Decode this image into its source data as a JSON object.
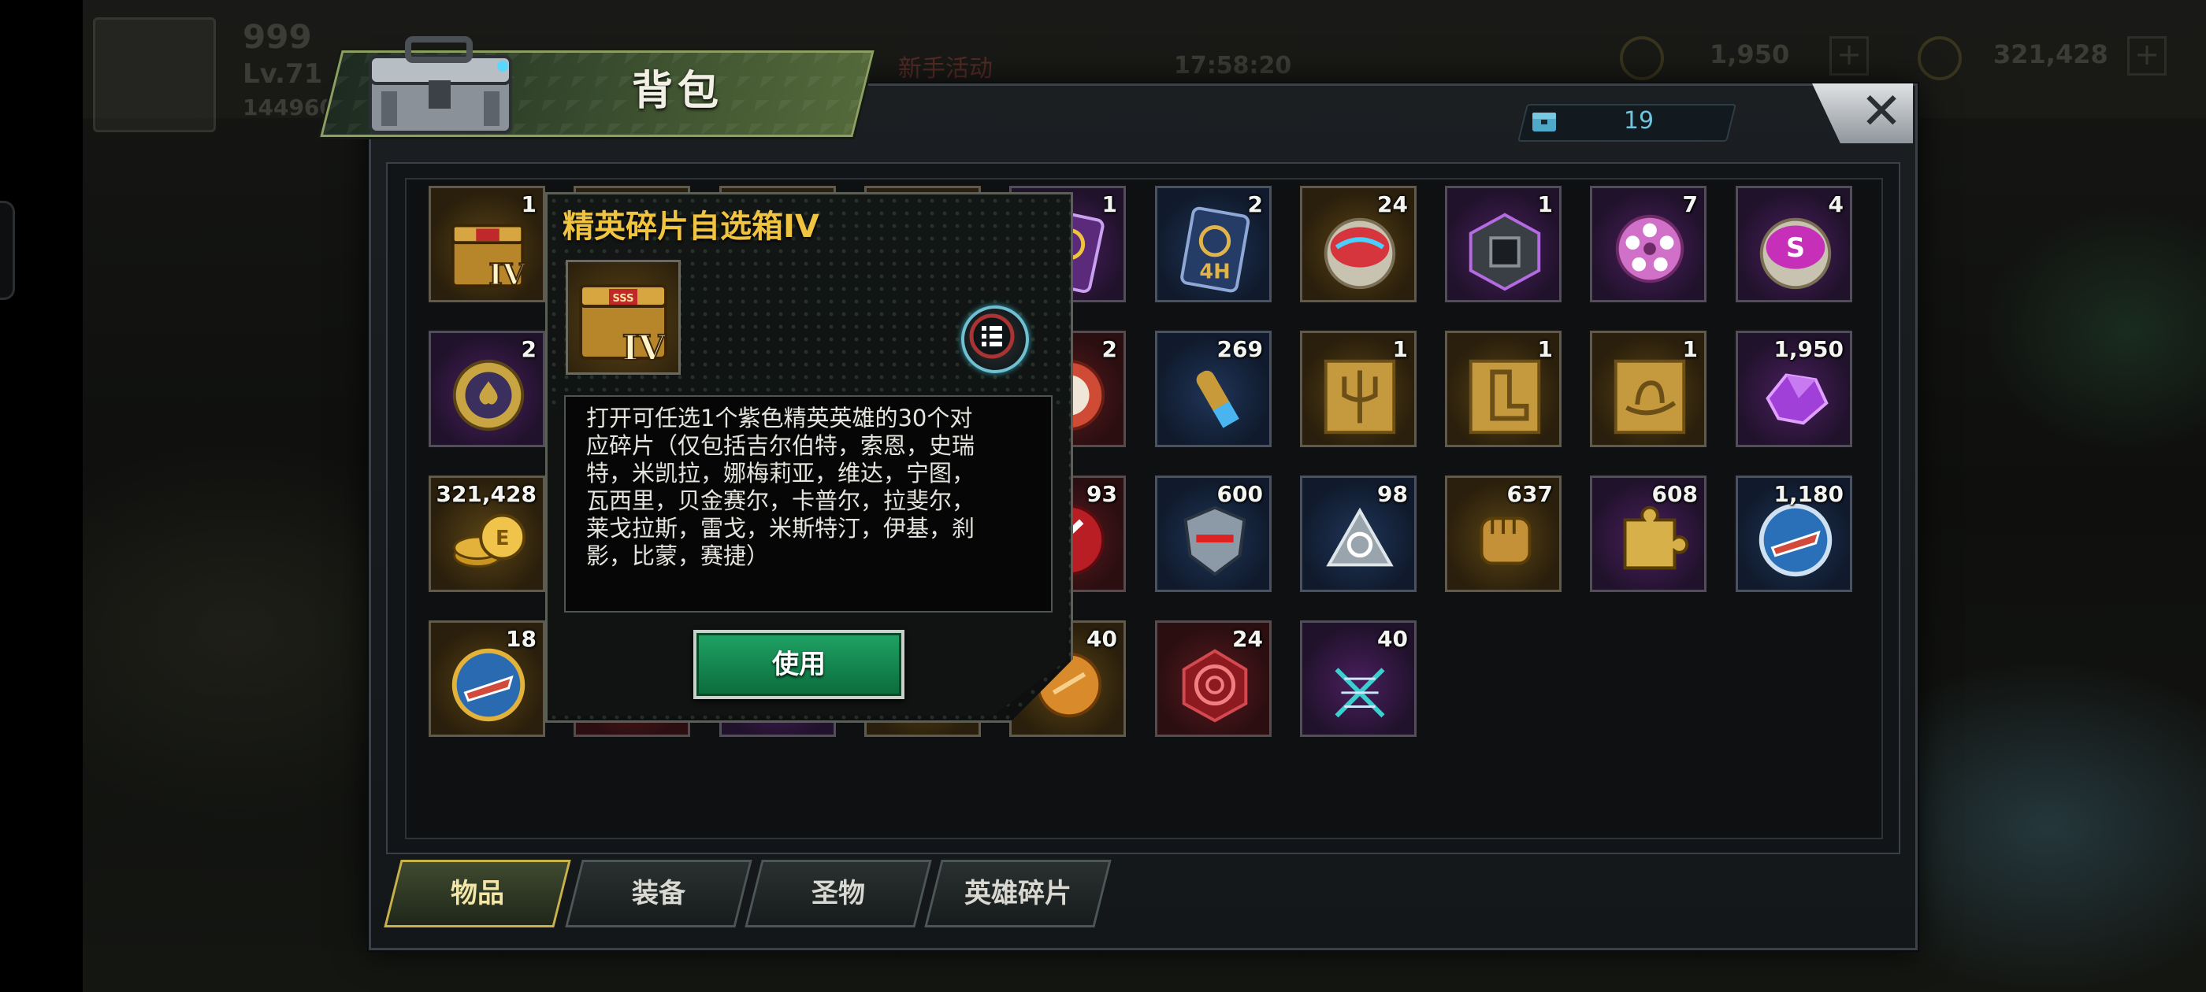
{
  "background": {
    "level_number": "999",
    "level_text": "Lv.71",
    "power_text": "144960",
    "event_label": "新手活动",
    "timer": "17:58:20",
    "resource_1": "1,950",
    "resource_2": "321,428"
  },
  "panel": {
    "title": "背包",
    "slot_counter": "19",
    "close_icon": "close-icon"
  },
  "items": [
    {
      "count": "1",
      "icon": "elite-box-icon",
      "rarity": "gold"
    },
    {
      "count": "",
      "icon": "hidden",
      "rarity": "gold"
    },
    {
      "count": "",
      "icon": "hidden",
      "rarity": "gold"
    },
    {
      "count": "",
      "icon": "hidden",
      "rarity": "gold"
    },
    {
      "count": "1",
      "icon": "speedup-card-icon",
      "rarity": "purple"
    },
    {
      "count": "2",
      "icon": "speedup-4h-card-icon",
      "rarity": "blue"
    },
    {
      "count": "24",
      "icon": "red-badge-icon",
      "rarity": "gold"
    },
    {
      "count": "1",
      "icon": "purple-cube-icon",
      "rarity": "purple"
    },
    {
      "count": "7",
      "icon": "film-reel-icon",
      "rarity": "purple"
    },
    {
      "count": "4",
      "icon": "purple-badge-icon",
      "rarity": "purple"
    },
    {
      "count": "2",
      "icon": "poker-chip-icon",
      "rarity": "purple"
    },
    {
      "count": "",
      "icon": "hidden",
      "rarity": "gold"
    },
    {
      "count": "",
      "icon": "hidden",
      "rarity": "gold"
    },
    {
      "count": "",
      "icon": "hidden",
      "rarity": "gold"
    },
    {
      "count": "2",
      "icon": "red-chip-icon",
      "rarity": "red"
    },
    {
      "count": "269",
      "icon": "bullet-icon",
      "rarity": "blue"
    },
    {
      "count": "1",
      "icon": "trident-blueprint-icon",
      "rarity": "gold"
    },
    {
      "count": "1",
      "icon": "boot-blueprint-icon",
      "rarity": "gold"
    },
    {
      "count": "1",
      "icon": "hat-blueprint-icon",
      "rarity": "gold"
    },
    {
      "count": "1,950",
      "icon": "purple-crystal-icon",
      "rarity": "purple"
    },
    {
      "count": "321,428",
      "icon": "gold-coins-icon",
      "rarity": "gold"
    },
    {
      "count": "",
      "icon": "hidden",
      "rarity": "gold"
    },
    {
      "count": "",
      "icon": "hidden",
      "rarity": "gold"
    },
    {
      "count": "",
      "icon": "hidden",
      "rarity": "gold"
    },
    {
      "count": "93",
      "icon": "red-medal-icon",
      "rarity": "red"
    },
    {
      "count": "600",
      "icon": "shield-emblem-icon",
      "rarity": "blue"
    },
    {
      "count": "98",
      "icon": "silver-triangle-icon",
      "rarity": "blue"
    },
    {
      "count": "637",
      "icon": "fist-icon",
      "rarity": "gold"
    },
    {
      "count": "608",
      "icon": "puzzle-piece-icon",
      "rarity": "purple"
    },
    {
      "count": "1,180",
      "icon": "blue-ship-badge-icon",
      "rarity": "blue"
    },
    {
      "count": "18",
      "icon": "gold-ship-badge-icon",
      "rarity": "gold"
    },
    {
      "count": "",
      "icon": "hidden",
      "rarity": "red"
    },
    {
      "count": "",
      "icon": "hidden",
      "rarity": "purple"
    },
    {
      "count": "",
      "icon": "hidden",
      "rarity": "gold"
    },
    {
      "count": "40",
      "icon": "gold-token-icon",
      "rarity": "gold"
    },
    {
      "count": "24",
      "icon": "red-target-icon",
      "rarity": "red"
    },
    {
      "count": "40",
      "icon": "dna-icon",
      "rarity": "purple"
    }
  ],
  "tooltip": {
    "title": "精英碎片自选箱IV",
    "description": "打开可任选1个紫色精英英雄的30个对\n应碎片（仅包括吉尔伯特，索恩，史瑞\n特，米凯拉，娜梅莉亚，维达，宁图，\n瓦西里，贝金赛尔，卡普尔，拉斐尔，\n莱戈拉斯，雷戈，米斯特汀，伊基，刹\n影，比蒙，赛捷）",
    "use_button": "使用",
    "box_label": "IV"
  },
  "tabs": [
    {
      "label": "物品",
      "active": true
    },
    {
      "label": "装备",
      "active": false
    },
    {
      "label": "圣物",
      "active": false
    },
    {
      "label": "英雄碎片",
      "active": false
    }
  ],
  "colors": {
    "title_gold": "#f0c440",
    "counter_cyan": "#6fc3df",
    "use_green": "#1fa365",
    "tab_active_border": "#c9b24a"
  }
}
